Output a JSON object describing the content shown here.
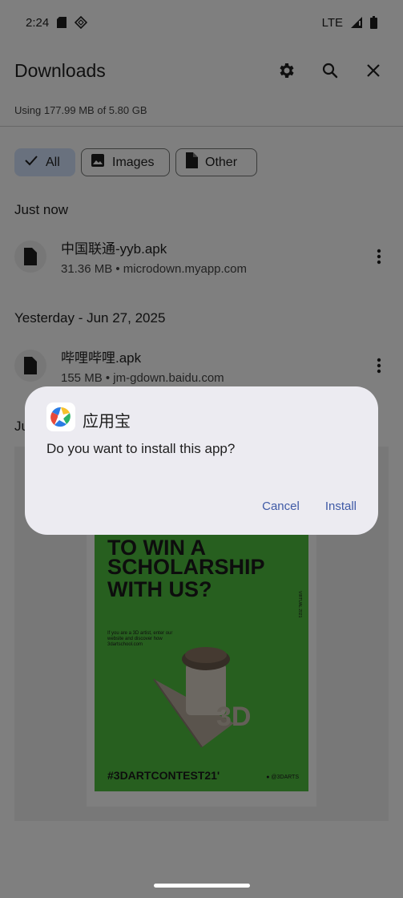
{
  "status_bar": {
    "time": "2:24",
    "network": "LTE",
    "icons": [
      "sd-card-icon",
      "vpn-diamond-icon",
      "signal-icon",
      "battery-icon"
    ]
  },
  "app_bar": {
    "title": "Downloads",
    "actions": [
      "settings-icon",
      "search-icon",
      "close-icon"
    ]
  },
  "storage_text": "Using 177.99 MB of 5.80 GB",
  "filters": [
    {
      "label": "All",
      "icon": "check-icon",
      "selected": true
    },
    {
      "label": "Images",
      "icon": "image-icon",
      "selected": false
    },
    {
      "label": "Other",
      "icon": "file-icon",
      "selected": false
    }
  ],
  "sections": [
    {
      "header": "Just now",
      "items": [
        {
          "name": "中国联通-yyb.apk",
          "meta": "31.36 MB • microdown.myapp.com"
        }
      ]
    },
    {
      "header": "Yesterday - Jun 27, 2025",
      "items": [
        {
          "name": "哔哩哔哩.apk",
          "meta": "155 MB • jm-gdown.baidu.com"
        }
      ]
    }
  ],
  "partial_section_header": "Ju",
  "preview_image": {
    "headline_partial": "TO WIN A",
    "headline_1": "SCHOLARSHIP",
    "headline_2": "WITH US?",
    "body_text": "If you are a 3D artist, enter our website and discover how 3dartschool.com",
    "side_text": "VIRTUAL 2021",
    "hashtag": "#3DARTCONTEST21'",
    "handle": "● @3DARTS",
    "art_label": "3D"
  },
  "dialog": {
    "app_name": "应用宝",
    "message": "Do you want to install this app?",
    "cancel_label": "Cancel",
    "install_label": "Install"
  },
  "colors": {
    "scrim": "#000000",
    "chip_selected": "#d3e3fd",
    "dialog_bg": "#ecebf1",
    "dialog_button": "#3f5aa6",
    "poster_green": "#4fbf3f"
  }
}
